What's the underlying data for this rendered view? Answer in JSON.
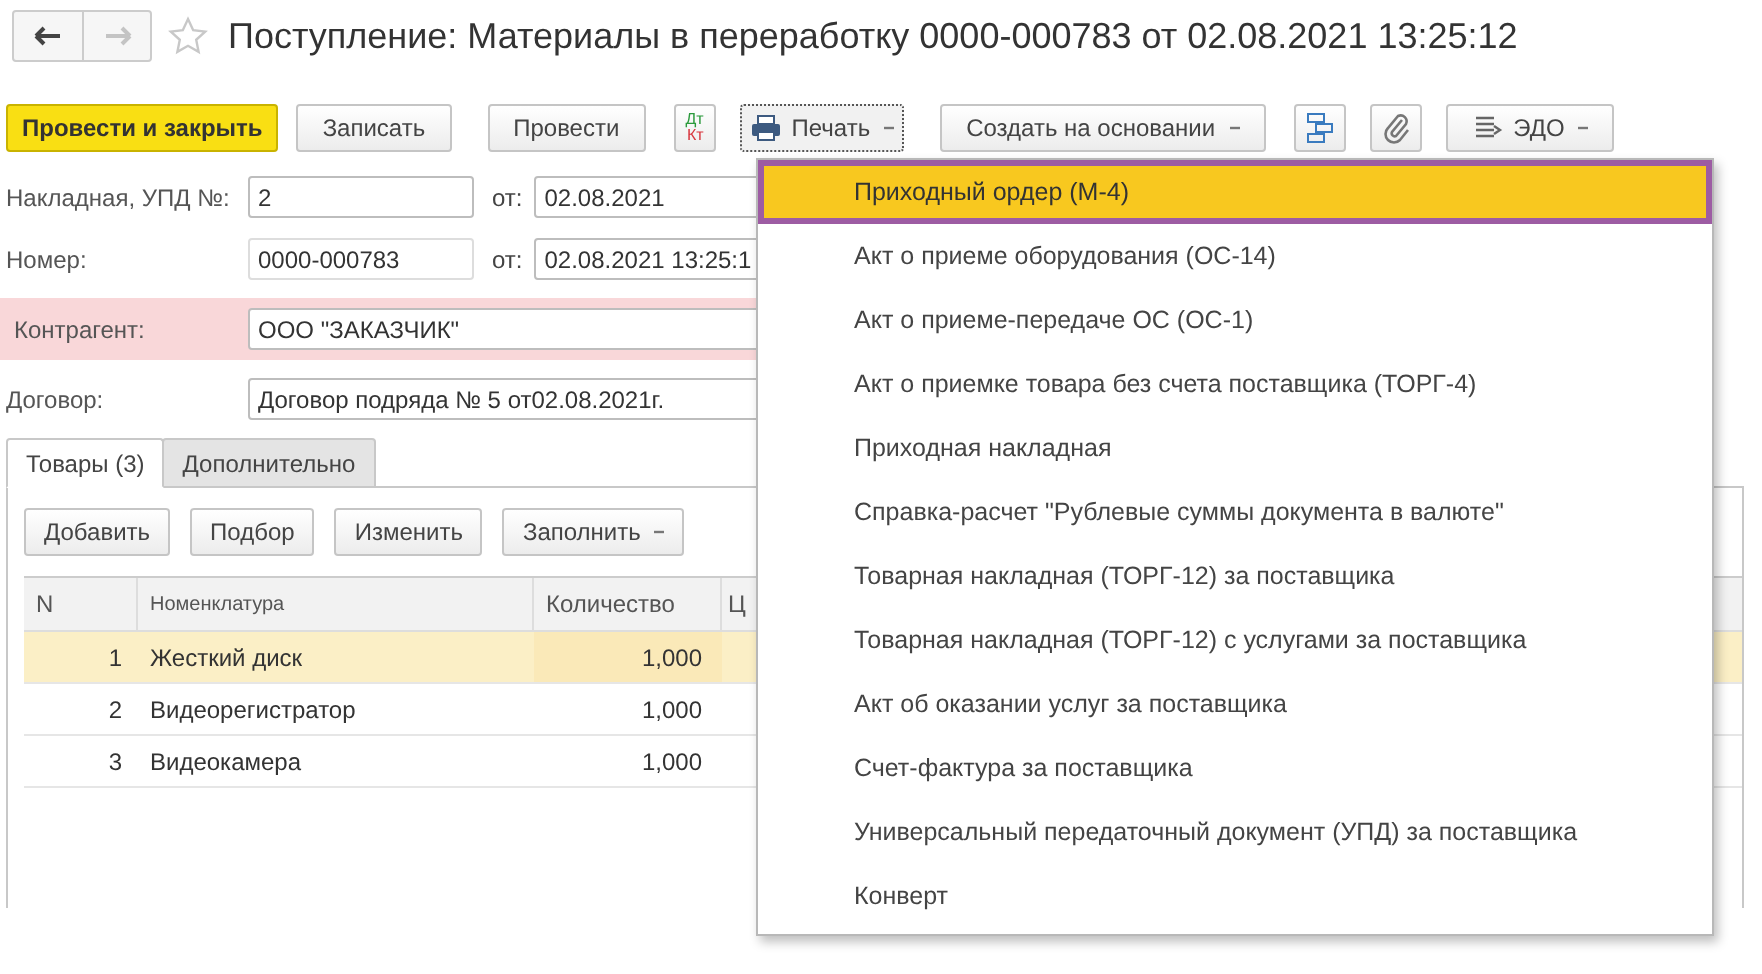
{
  "window": {
    "title": "Поступление: Материалы в переработку 0000-000783 от 02.08.2021 13:25:12"
  },
  "nav": [
    {
      "kind": "back",
      "disabled": false
    },
    {
      "kind": "forward",
      "disabled": true
    }
  ],
  "toolbar": [
    {
      "kind": "primary",
      "label": "Провести и закрыть"
    },
    {
      "kind": "plain",
      "label": "Записать"
    },
    {
      "kind": "plain",
      "label": "Провести"
    },
    {
      "kind": "dtkt",
      "debit": "Дт",
      "credit": "Кт"
    },
    {
      "kind": "print",
      "label": "Печать",
      "expanded": true
    },
    {
      "kind": "menu",
      "label": "Создать на основании",
      "expanded": false
    },
    {
      "kind": "structure"
    },
    {
      "kind": "attach"
    },
    {
      "kind": "edo",
      "label": "ЭДО",
      "expanded": false
    }
  ],
  "form": [
    {
      "label": "Накладная, УПД №:",
      "value": "2",
      "readonly": false,
      "highlighted": false,
      "date_label": "от:",
      "date": "02.08.2021"
    },
    {
      "label": "Номер:",
      "value": "0000-000783",
      "readonly": true,
      "highlighted": false,
      "date_label": "от:",
      "date": "02.08.2021 13:25:1"
    },
    {
      "label": "Контрагент:",
      "value": "ООО \"ЗАКАЗЧИК\"",
      "readonly": false,
      "highlighted": true
    },
    {
      "label": "Договор:",
      "value": "Договор подряда № 5 от02.08.2021г.",
      "readonly": false,
      "highlighted": false
    }
  ],
  "tabs": [
    {
      "label": "Товары (3)",
      "selected": true
    },
    {
      "label": "Дополнительно",
      "selected": false
    }
  ],
  "table_buttons": [
    {
      "kind": "plain",
      "label": "Добавить"
    },
    {
      "kind": "plain",
      "label": "Подбор"
    },
    {
      "kind": "plain",
      "label": "Изменить"
    },
    {
      "kind": "menu",
      "label": "Заполнить"
    }
  ],
  "table": {
    "columns": [
      "N",
      "Номенклатура",
      "Количество",
      "Ц"
    ],
    "rows": [
      {
        "n": "1",
        "name": "Жесткий диск",
        "qty": "1,000",
        "selected": true
      },
      {
        "n": "2",
        "name": "Видеорегистратор",
        "qty": "1,000",
        "selected": false
      },
      {
        "n": "3",
        "name": "Видеокамера",
        "qty": "1,000",
        "selected": false
      }
    ]
  },
  "print_menu": [
    {
      "label": "Приходный ордер (М-4)",
      "selected": true
    },
    {
      "label": "Акт о приеме оборудования (ОС-14)",
      "selected": false
    },
    {
      "label": "Акт о приеме-передаче ОС (ОС-1)",
      "selected": false
    },
    {
      "label": "Акт о приемке товара без счета поставщика (ТОРГ-4)",
      "selected": false
    },
    {
      "label": "Приходная накладная",
      "selected": false
    },
    {
      "label": "Справка-расчет \"Рублевые суммы документа в валюте\"",
      "selected": false
    },
    {
      "label": "Товарная накладная (ТОРГ-12) за поставщика",
      "selected": false
    },
    {
      "label": "Товарная накладная (ТОРГ-12) с услугами за поставщика",
      "selected": false
    },
    {
      "label": "Акт об оказании услуг за поставщика",
      "selected": false
    },
    {
      "label": "Счет-фактура за поставщика",
      "selected": false
    },
    {
      "label": "Универсальный передаточный документ (УПД) за поставщика",
      "selected": false
    },
    {
      "label": "Конверт",
      "selected": false
    }
  ]
}
